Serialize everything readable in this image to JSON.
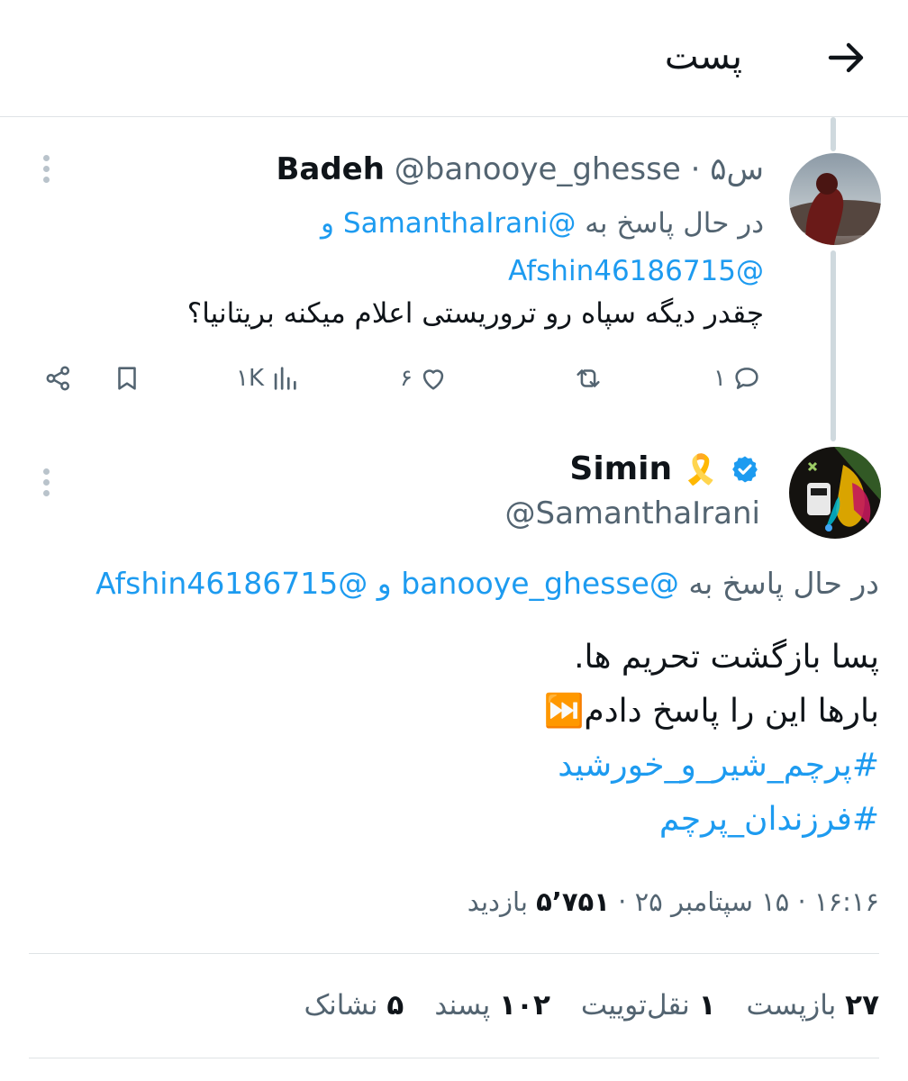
{
  "header": {
    "title": "پست",
    "back_icon": "arrow-right-icon"
  },
  "reply": {
    "name": "Badeh",
    "handle": "@banooye_ghesse",
    "time": "۵س",
    "sep": "·",
    "replying_prefix": "در حال پاسخ به",
    "replying_user1": "@SamanthaIrani",
    "replying_and": "و",
    "replying_user2": "@Afshin46186715",
    "text": "چقدر دیگه سپاه رو تروریستی اعلام میکنه بریتانیا؟",
    "actions": {
      "replies": "۱",
      "retweets": "",
      "likes": "۶",
      "views": "۱K"
    }
  },
  "tweet": {
    "name": "Simin",
    "emoji": "🎗️",
    "handle": "@SamanthaIrani",
    "replying_prefix": "در حال پاسخ به",
    "replying_user1": "@banooye_ghesse",
    "replying_and": "و",
    "replying_user2": "@Afshin46186715",
    "line1": "پسا بازگشت تحریم ها.",
    "line2": "بارها این را پاسخ دادم",
    "line2_emoji": "⏭️",
    "hashtag1": "#پرچم_شیر_و_خورشید",
    "hashtag2": "#فرزندان_پرچم",
    "time": "۱۶:۱۶",
    "date": "۱۵ سپتامبر ۲۵",
    "views_count": "۵٬۷۵۱",
    "views_label": "بازدید",
    "sep": "·"
  },
  "stats": [
    {
      "count": "۲۷",
      "label": "بازپست"
    },
    {
      "count": "۱",
      "label": "نقل‌توییت"
    },
    {
      "count": "۱۰۲",
      "label": "پسند"
    },
    {
      "count": "۵",
      "label": "نشانک"
    }
  ],
  "colors": {
    "link": "#1d9bf0",
    "muted": "#536471",
    "verified": "#1d9bf0"
  }
}
